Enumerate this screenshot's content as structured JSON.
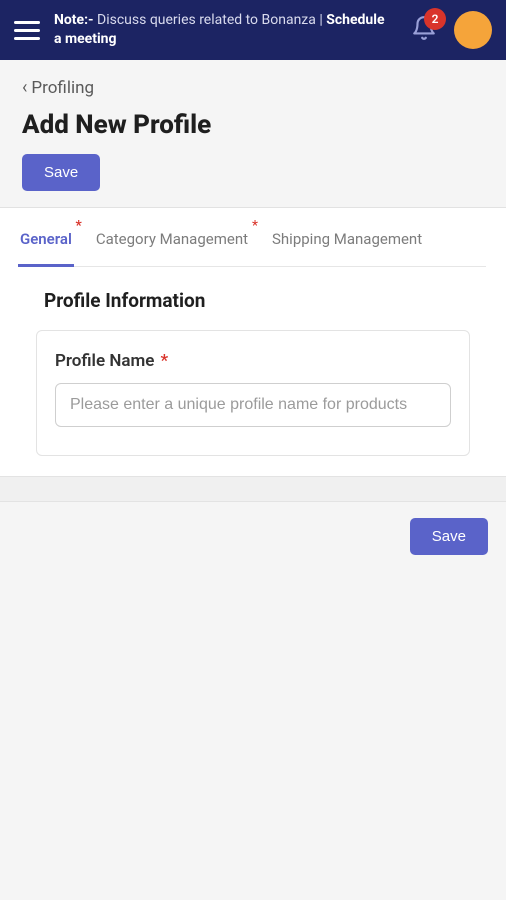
{
  "header": {
    "note_prefix": "Note:-",
    "note_text": "Discuss queries related to Bonanza | ",
    "note_cta": "Schedule a meeting",
    "notification_count": "2"
  },
  "breadcrumb": {
    "label": "Profiling"
  },
  "page": {
    "title": "Add New Profile",
    "save_top": "Save",
    "save_bottom": "Save"
  },
  "tabs": [
    {
      "label": "General",
      "required": true,
      "active": true
    },
    {
      "label": "Category Management",
      "required": true,
      "active": false
    },
    {
      "label": "Shipping Management",
      "required": false,
      "active": false
    }
  ],
  "section": {
    "title": "Profile Information"
  },
  "form": {
    "profile_name_label": "Profile Name",
    "profile_name_placeholder": "Please enter a unique profile name for products"
  }
}
